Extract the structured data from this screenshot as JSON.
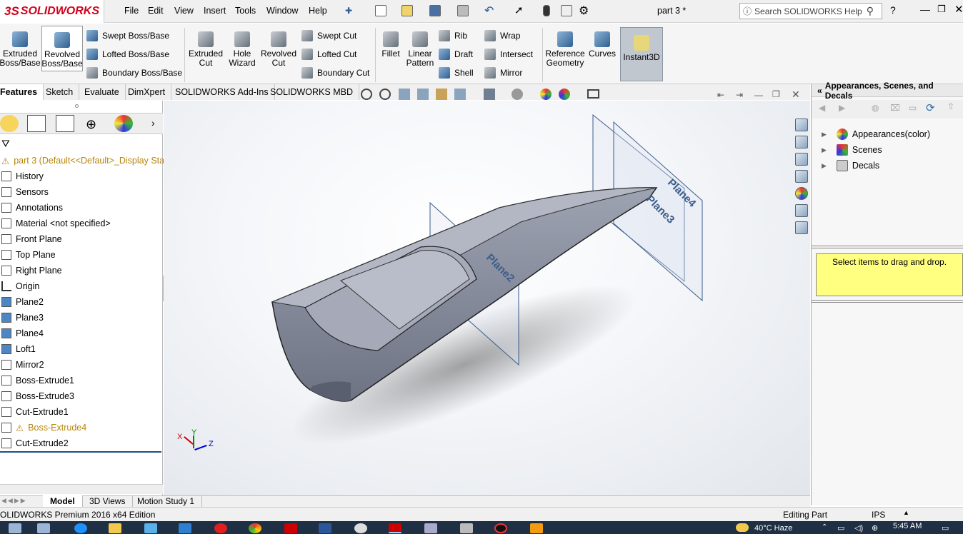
{
  "app": {
    "brand": "SOLIDWORKS",
    "brand_prefix": "3S",
    "doc_title": "part 3 *"
  },
  "menu": [
    "File",
    "Edit",
    "View",
    "Insert",
    "Tools",
    "Window",
    "Help"
  ],
  "help_search": {
    "placeholder": "Search SOLIDWORKS Help"
  },
  "ribbon": {
    "extruded_boss": "Extruded Boss/Base",
    "revolved_boss": "Revolved Boss/Base",
    "swept_boss": "Swept Boss/Base",
    "lofted_boss": "Lofted Boss/Base",
    "boundary_boss": "Boundary Boss/Base",
    "extruded_cut": "Extruded Cut",
    "hole_wizard": "Hole Wizard",
    "revolved_cut": "Revolved Cut",
    "swept_cut": "Swept Cut",
    "lofted_cut": "Lofted Cut",
    "boundary_cut": "Boundary Cut",
    "fillet": "Fillet",
    "linear_pattern": "Linear Pattern",
    "rib": "Rib",
    "draft": "Draft",
    "shell": "Shell",
    "wrap": "Wrap",
    "intersect": "Intersect",
    "mirror": "Mirror",
    "reference_geometry": "Reference Geometry",
    "curves": "Curves",
    "instant3d": "Instant3D"
  },
  "command_tabs": [
    "Features",
    "Sketch",
    "Evaluate",
    "DimXpert",
    "SOLIDWORKS Add-Ins",
    "SOLIDWORKS MBD"
  ],
  "tree": {
    "root": "part 3  (Default<<Default>_Display Sta",
    "items": [
      "History",
      "Sensors",
      "Annotations",
      "Material <not specified>",
      "Front Plane",
      "Top Plane",
      "Right Plane",
      "Origin",
      "Plane2",
      "Plane3",
      "Plane4",
      "Loft1",
      "Mirror2",
      "Boss-Extrude1",
      "Boss-Extrude3",
      "Cut-Extrude1",
      "Boss-Extrude4",
      "Cut-Extrude2"
    ]
  },
  "viewport": {
    "plane_labels": [
      "Plane2",
      "Plane3",
      "Plane4"
    ],
    "triad": [
      "X",
      "Y",
      "Z"
    ]
  },
  "right_panel": {
    "title": "Appearances, Scenes, and Decals",
    "items": [
      "Appearances(color)",
      "Scenes",
      "Decals"
    ],
    "note": "Select items to drag and drop."
  },
  "bottom_tabs": [
    "Model",
    "3D Views",
    "Motion Study 1"
  ],
  "status": {
    "edition": "OLIDWORKS Premium 2016 x64 Edition",
    "mode": "Editing Part",
    "units": "IPS"
  },
  "taskbar": {
    "weather": "40°C  Haze",
    "time": "5:45 AM"
  },
  "colors": {
    "accent": "#d0021b",
    "warning": "#b8860b",
    "note_bg": "#ffff80"
  }
}
